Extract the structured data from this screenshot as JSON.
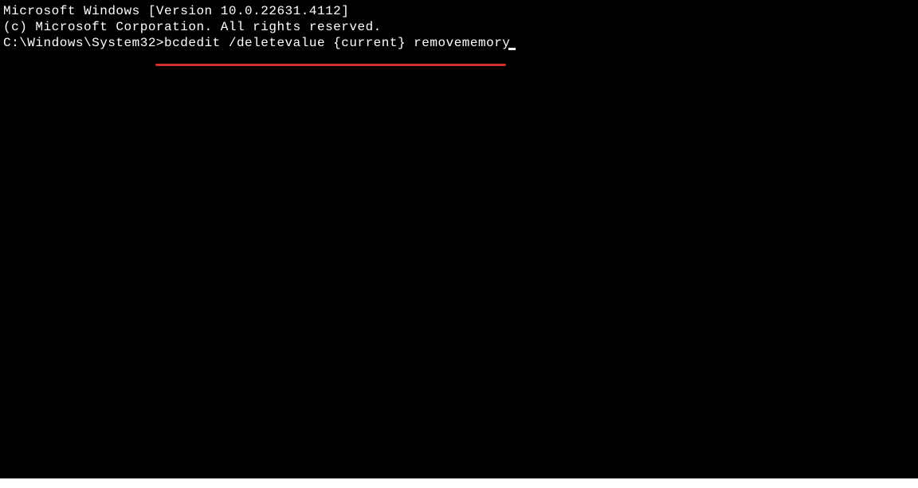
{
  "terminal": {
    "header_line1": "Microsoft Windows [Version 10.0.22631.4112]",
    "header_line2": "(c) Microsoft Corporation. All rights reserved.",
    "blank_line": "",
    "prompt": "C:\\Windows\\System32>",
    "command": "bcdedit /deletevalue {current} removememory",
    "highlight_color": "#D32F2F"
  }
}
